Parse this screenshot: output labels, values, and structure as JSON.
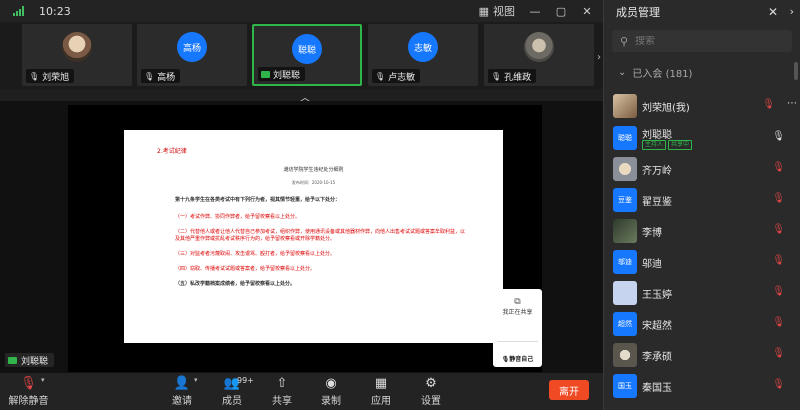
{
  "titlebar": {
    "time": "10:23",
    "view_label": "视图"
  },
  "strip": {
    "tiles": [
      {
        "name": "刘荣旭",
        "avatar": "",
        "active": false
      },
      {
        "name": "高杨",
        "avatar": "高杨",
        "active": false
      },
      {
        "name": "刘聪聪",
        "avatar": "聪聪",
        "active": true
      },
      {
        "name": "卢志敏",
        "avatar": "志敏",
        "active": false
      },
      {
        "name": "孔维政",
        "avatar": "",
        "active": false
      }
    ]
  },
  "share": {
    "sharer": "刘聪聪",
    "doc": {
      "section": "2.考试纪律",
      "title": "潍坊学院学生违纪处分细则",
      "date": "发布时间：2020-10-15",
      "intro": "第十九条学生在各类考试中有下列行为者，视其情节轻重，给予以下处分：",
      "items": [
        "（一）考试作弊、协同作弊者，给予留校察看以上处分。",
        "（二）代替他人或者让他人代替自己参加考试，组织作弊，使用通讯设备或其他器材作弊，向他人出售考试试题或答案牟取利益，以及其他严重作弊或扰乱考试秩序行为的，给予留校察看或开除学籍处分。",
        "（三）对监考者污蔑取闹、攻击谩骂、殴打者，给予留校察看以上处分。",
        "（四）窃取、传播考试试题或答案者，给予留校察看以上处分。",
        "（五）私改学籍档案成绩者，给予留校察看以上处分。"
      ]
    },
    "panel": {
      "sharing_label": "我正在共享",
      "mute_self": "静音自己"
    }
  },
  "toolbar": {
    "mute": "解除静音",
    "invite": "邀请",
    "members": "成员",
    "member_count": "99+",
    "share": "共享",
    "record": "录制",
    "apps": "应用",
    "settings": "设置",
    "leave": "离开"
  },
  "panel": {
    "title": "成员管理",
    "search_placeholder": "搜索",
    "group_label": "已入会 (181)",
    "members": [
      {
        "name": "刘荣旭(我)",
        "avatar": "",
        "mic": "off"
      },
      {
        "name": "刘聪聪",
        "avatar": "聪聪",
        "tags": [
          "主持人",
          "共享中"
        ],
        "mic": "on"
      },
      {
        "name": "齐万岭",
        "avatar": "",
        "mic": "off"
      },
      {
        "name": "翟豆鉴",
        "avatar": "豆鉴",
        "mic": "off"
      },
      {
        "name": "李博",
        "avatar": "",
        "mic": "off"
      },
      {
        "name": "邬迪",
        "avatar": "邬迪",
        "mic": "off"
      },
      {
        "name": "王玉婷",
        "avatar": "",
        "mic": "off"
      },
      {
        "name": "宋超然",
        "avatar": "超然",
        "mic": "off"
      },
      {
        "name": "李承硕",
        "avatar": "",
        "mic": "off"
      },
      {
        "name": "秦国玉",
        "avatar": "国玉",
        "mic": "off"
      }
    ]
  }
}
